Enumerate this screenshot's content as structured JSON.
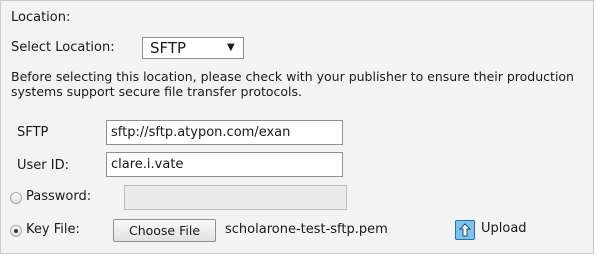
{
  "section": {
    "heading": "Location:"
  },
  "select_location": {
    "label": "Select Location:",
    "selected": "SFTP",
    "arrow": "▼"
  },
  "info": {
    "text": "Before selecting this location, please check with your publisher to ensure their production systems support secure file transfer protocols."
  },
  "sftp": {
    "label": "SFTP",
    "value": "sftp://sftp.atypon.com/exan"
  },
  "user_id": {
    "label": "User ID:",
    "value": "clare.i.vate"
  },
  "password": {
    "label": "Password:",
    "value": "",
    "selected": false
  },
  "key_file": {
    "label": "Key File:",
    "choose_button": "Choose File",
    "file_name": "scholarone-test-sftp.pem",
    "selected": true
  },
  "upload": {
    "label": "Upload",
    "icon": "upload-arrow-icon"
  },
  "colors": {
    "panel_background": "#f3f3f3",
    "upload_icon_fill": "#7cc4ee",
    "upload_icon_border": "#2a6fa8"
  }
}
